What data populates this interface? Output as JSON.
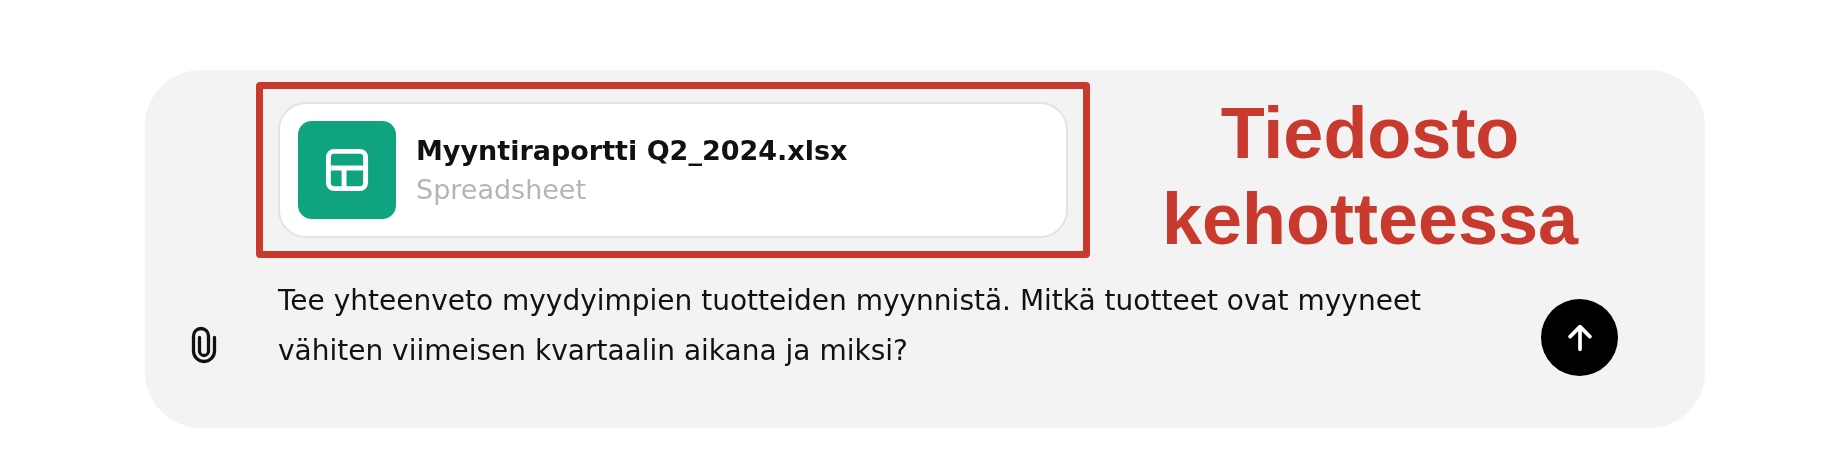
{
  "attachment": {
    "name": "Myyntiraportti Q2_2024.xlsx",
    "type": "Spreadsheet",
    "highlighted": true
  },
  "annotation": {
    "label": "Tiedosto kehotteessa"
  },
  "prompt": {
    "value": "Tee yhteenveto myydyimpien tuotteiden myynnistä. Mitkä tuotteet ovat myyneet vähiten viimeisen kvartaalin aikana ja miksi?"
  }
}
